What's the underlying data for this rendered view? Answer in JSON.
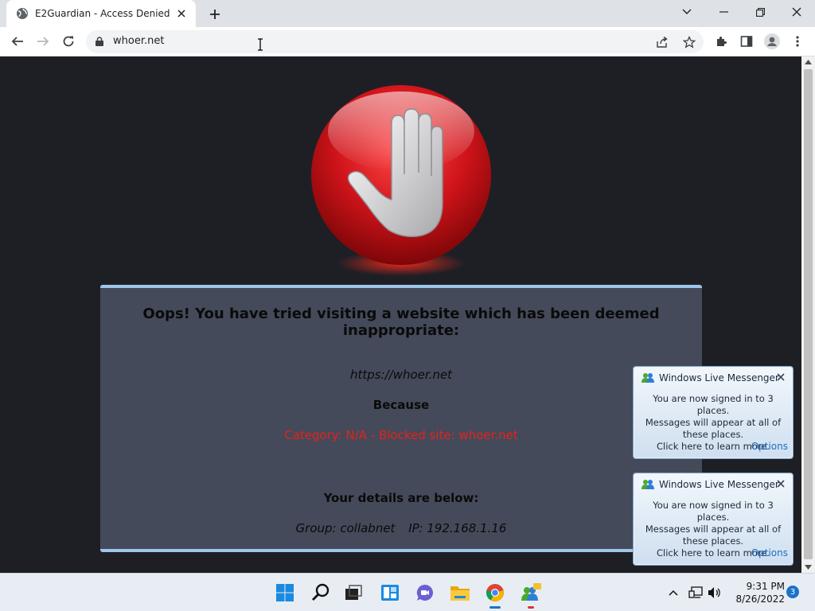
{
  "browser": {
    "tab_title": "E2Guardian - Access Denied",
    "url": "whoer.net"
  },
  "page": {
    "headline": "Oops! You have tried visiting a website which has been deemed inappropriate:",
    "blocked_url": "https://whoer.net",
    "because_label": "Because",
    "reason": "Category: N/A - Blocked site: whoer.net",
    "details_label": "Your details are below:",
    "group": "Group: collabnet",
    "ip": "IP: 192.168.1.16",
    "colors": {
      "panel": "#444a5a",
      "panel_border": "#9fc6ea",
      "reason": "#e8201a",
      "stop_red": "#d0141a"
    }
  },
  "notifications": [
    {
      "app": "Windows Live Messenger",
      "line1": "You are now signed in to 3 places.",
      "line2": "Messages will appear at all of these places.",
      "line3": "Click here to learn more.",
      "options": "Options"
    },
    {
      "app": "Windows Live Messenger",
      "line1": "You are now signed in to 3 places.",
      "line2": "Messages will appear at all of these places.",
      "line3": "Click here to learn more.",
      "options": "Options"
    }
  ],
  "taskbar": {
    "time": "9:31 PM",
    "date": "8/26/2022",
    "notification_count": "3",
    "apps": [
      "start-icon",
      "search-icon",
      "task-view-icon",
      "widgets-icon",
      "chat-icon",
      "file-explorer-icon",
      "chrome-icon",
      "messenger-icon"
    ]
  }
}
